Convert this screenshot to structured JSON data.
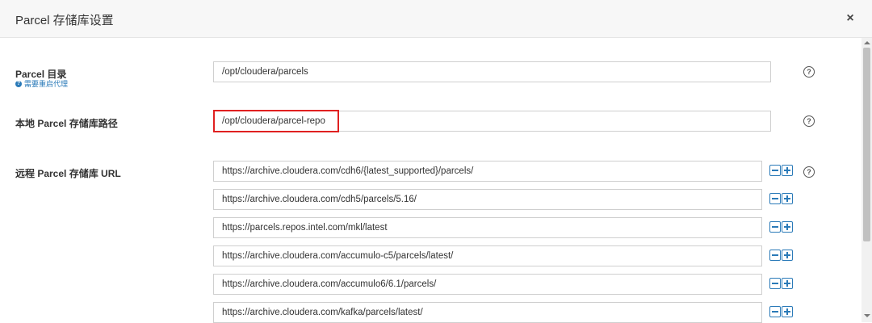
{
  "dialog": {
    "title": "Parcel 存储库设置",
    "close_glyph": "×"
  },
  "parcel_dir": {
    "label": "Parcel 目录",
    "note": "需要重启代理",
    "value": "/opt/cloudera/parcels",
    "help": "?"
  },
  "local_repo": {
    "label": "本地 Parcel 存储库路径",
    "value": "/opt/cloudera/parcel-repo",
    "help": "?",
    "highlight_color": "#e02020"
  },
  "remote_repo": {
    "label": "远程 Parcel 存储库 URL",
    "help": "?",
    "urls": [
      "https://archive.cloudera.com/cdh6/{latest_supported}/parcels/",
      "https://archive.cloudera.com/cdh5/parcels/5.16/",
      "https://parcels.repos.intel.com/mkl/latest",
      "https://archive.cloudera.com/accumulo-c5/parcels/latest/",
      "https://archive.cloudera.com/accumulo6/6.1/parcels/",
      "https://archive.cloudera.com/kafka/parcels/latest/"
    ]
  },
  "icons": {
    "help": "question-circle-icon",
    "remove": "minus-square-icon",
    "add": "plus-square-icon",
    "close": "close-icon"
  },
  "colors": {
    "accent": "#2a7ab8",
    "highlight": "#e02020"
  }
}
